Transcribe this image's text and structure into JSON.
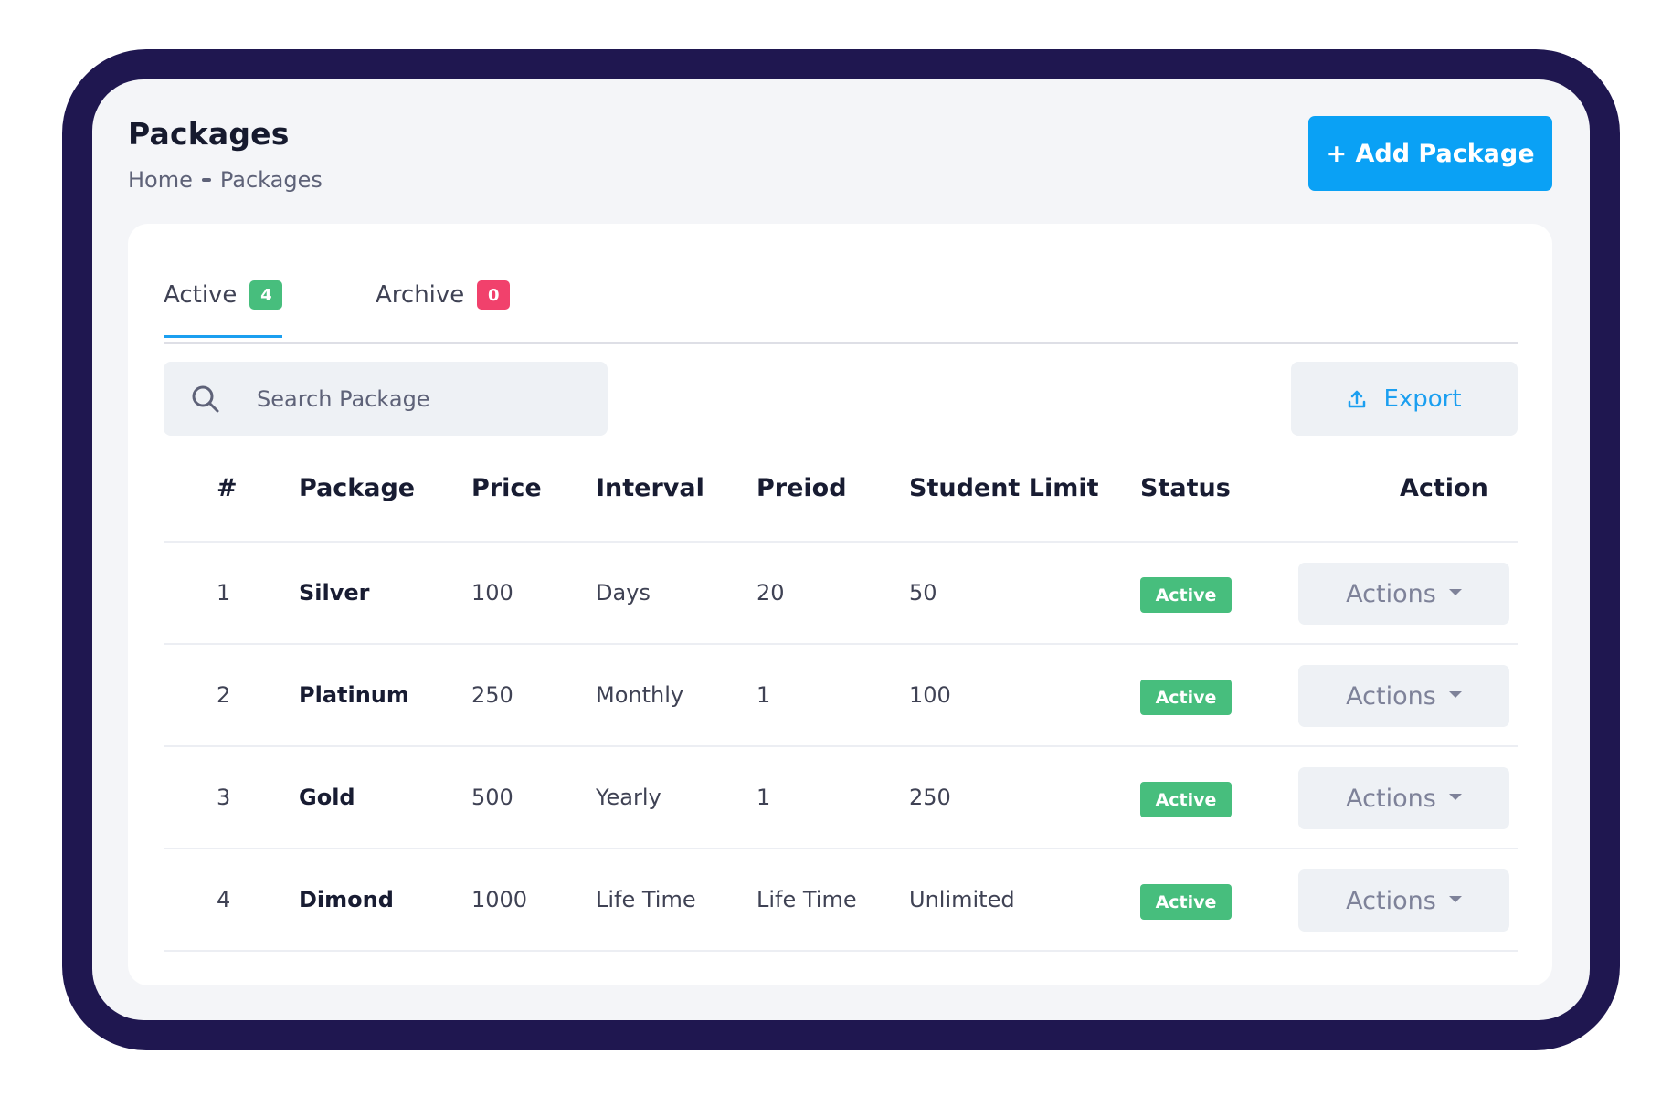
{
  "header": {
    "title": "Packages",
    "breadcrumb": [
      "Home",
      "Packages"
    ],
    "add_button_label": "+ Add Package"
  },
  "tabs": [
    {
      "label": "Active",
      "count": "4",
      "color": "#47be7d",
      "active": true
    },
    {
      "label": "Archive",
      "count": "0",
      "color": "#f1416c",
      "active": false
    }
  ],
  "search": {
    "placeholder": "Search Package",
    "value": ""
  },
  "export_label": "Export",
  "table": {
    "columns": [
      "#",
      "Package",
      "Price",
      "Interval",
      "Preiod",
      "Student Limit",
      "Status",
      "Action"
    ],
    "rows": [
      {
        "num": "1",
        "package": "Silver",
        "price": "100",
        "interval": "Days",
        "period": "20",
        "limit": "50",
        "status": "Active",
        "action": "Actions"
      },
      {
        "num": "2",
        "package": "Platinum",
        "price": "250",
        "interval": "Monthly",
        "period": "1",
        "limit": "100",
        "status": "Active",
        "action": "Actions"
      },
      {
        "num": "3",
        "package": "Gold",
        "price": "500",
        "interval": "Yearly",
        "period": "1",
        "limit": "250",
        "status": "Active",
        "action": "Actions"
      },
      {
        "num": "4",
        "package": "Dimond",
        "price": "1000",
        "interval": "Life Time",
        "period": "Life Time",
        "limit": "Unlimited",
        "status": "Active",
        "action": "Actions"
      }
    ]
  },
  "colors": {
    "primary": "#0aa1f5",
    "success": "#47be7d",
    "danger": "#f1416c",
    "frame": "#1f1750"
  }
}
